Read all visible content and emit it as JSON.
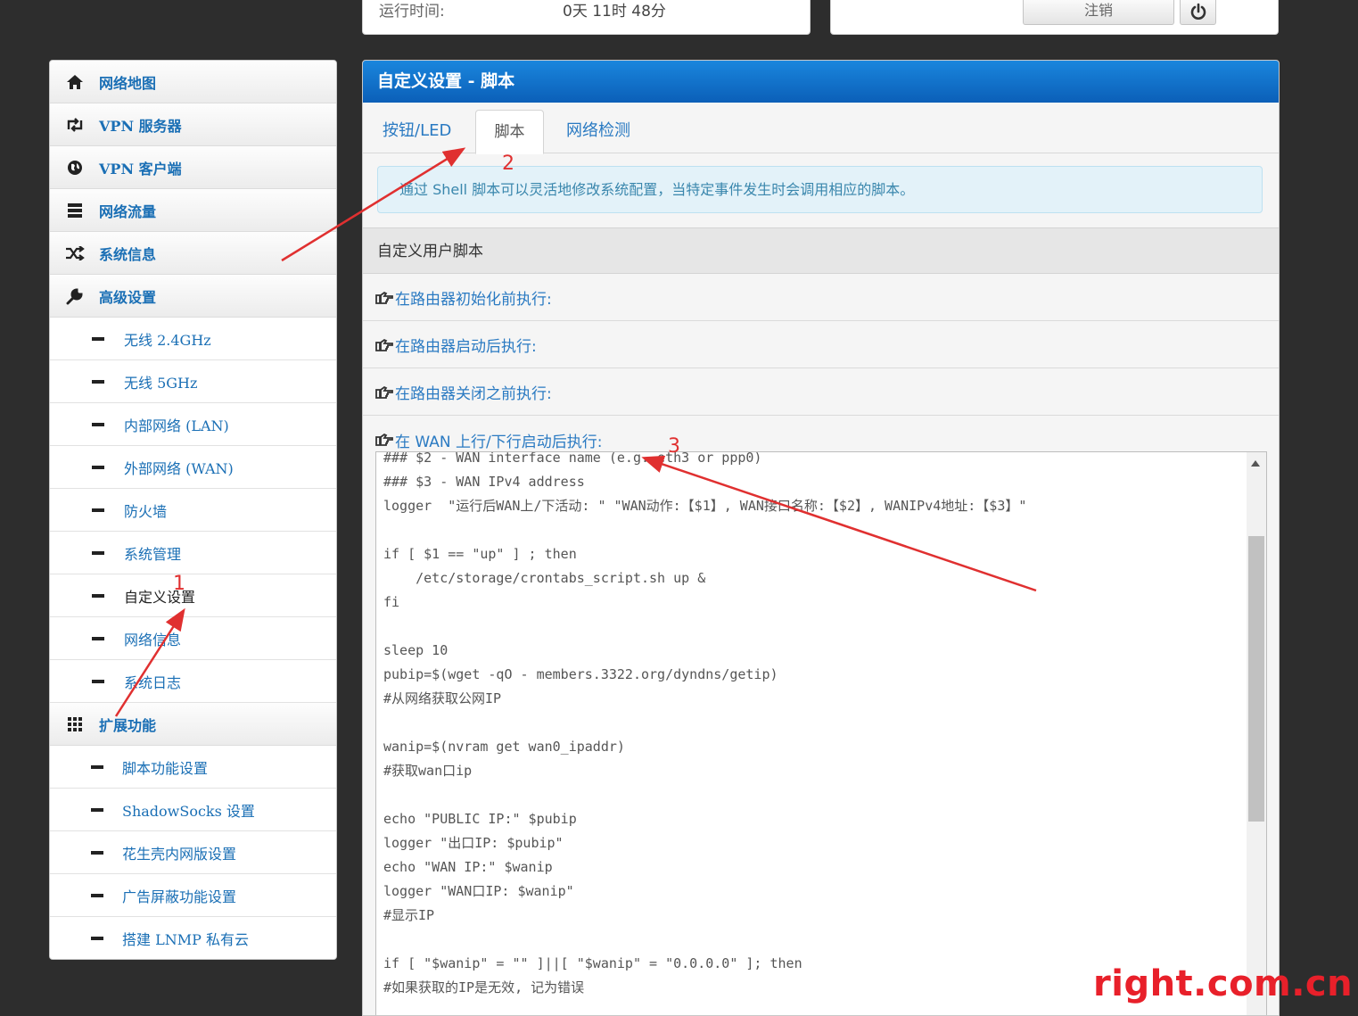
{
  "status": {
    "uptime_label": "运行时间:",
    "uptime_value": "0天 11时 48分",
    "logout_label": "注销"
  },
  "sidebar": {
    "items": [
      {
        "label": "网络地图",
        "icon": "home-icon"
      },
      {
        "label": "VPN 服务器",
        "icon": "retweet-icon"
      },
      {
        "label": "VPN 客户端",
        "icon": "globe-icon"
      },
      {
        "label": "网络流量",
        "icon": "server-icon"
      },
      {
        "label": "系统信息",
        "icon": "shuffle-icon"
      },
      {
        "label": "高级设置",
        "icon": "wrench-icon"
      }
    ],
    "advanced": [
      "无线 2.4GHz",
      "无线 5GHz",
      "内部网络 (LAN)",
      "外部网络 (WAN)",
      "防火墙",
      "系统管理",
      "自定义设置",
      "网络信息",
      "系统日志"
    ],
    "extensions_label": "扩展功能",
    "extensions": [
      "脚本功能设置",
      "ShadowSocks 设置",
      "花生壳内网版设置",
      "广告屏蔽功能设置",
      "搭建 LNMP 私有云"
    ]
  },
  "main": {
    "title": "自定义设置 - 脚本",
    "tabs": [
      "按钮/LED",
      "脚本",
      "网络检测"
    ],
    "info": "通过 Shell 脚本可以灵活地修改系统配置，当特定事件发生时会调用相应的脚本。",
    "section_title": "自定义用户脚本",
    "rows": [
      "在路由器初始化前执行:",
      "在路由器启动后执行:",
      "在路由器关闭之前执行:",
      "在 WAN 上行/下行启动后执行:"
    ],
    "code_lines": [
      "### $2 - WAN interface name (e.g. eth3 or ppp0)",
      "### $3 - WAN IPv4 address",
      "logger  \"运行后WAN上/下活动: \" \"WAN动作:【$1】, WAN接口名称:【$2】, WANIPv4地址:【$3】\"",
      "",
      "if [ $1 == \"up\" ] ; then",
      "    /etc/storage/crontabs_script.sh up &",
      "fi",
      "",
      "sleep 10",
      "pubip=$(wget -qO - members.3322.org/dyndns/getip)",
      "#从网络获取公网IP",
      "",
      "wanip=$(nvram get wan0_ipaddr)",
      "#获取wan口ip",
      "",
      "echo \"PUBLIC IP:\" $pubip",
      "logger \"出口IP: $pubip\"",
      "echo \"WAN IP:\" $wanip",
      "logger \"WAN口IP: $wanip\"",
      "#显示IP",
      "",
      "if [ \"$wanip\" = \"\" ]||[ \"$wanip\" = \"0.0.0.0\" ]; then",
      "#如果获取的IP是无效, 记为错误"
    ]
  },
  "annotations": [
    "1",
    "2",
    "3"
  ],
  "watermark": "right.com.cn",
  "colors": {
    "link": "#1a6fb5",
    "header_blue": "#0b6fcc",
    "annotation_red": "#e03030"
  }
}
